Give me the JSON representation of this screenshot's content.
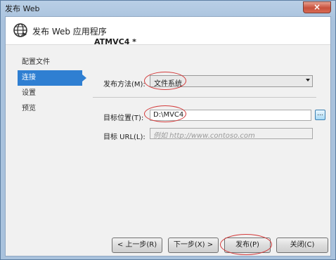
{
  "window": {
    "title": "发布 Web",
    "close_symbol": "×"
  },
  "header": {
    "title": "发布 Web 应用程序",
    "icon": "globe-icon"
  },
  "nav": {
    "items": [
      {
        "label": "配置文件",
        "active": false
      },
      {
        "label": "连接",
        "active": true
      },
      {
        "label": "设置",
        "active": false
      },
      {
        "label": "预览",
        "active": false
      }
    ]
  },
  "profile": {
    "name": "ATMVC4 *"
  },
  "publish_method": {
    "label": "发布方法(M):",
    "value": "文件系统"
  },
  "target_location": {
    "label": "目标位置(T):",
    "value": "D:\\MVC4",
    "browse_label": "..."
  },
  "target_url": {
    "label": "目标 URL(L):",
    "placeholder": "例如 http://www.contoso.com"
  },
  "buttons": {
    "prev": "< 上一步(R)",
    "next": "下一步(X) >",
    "publish": "发布(P)",
    "close": "关闭(C)"
  },
  "colors": {
    "accent": "#2f7fd2",
    "annotation": "#d33a3a"
  }
}
